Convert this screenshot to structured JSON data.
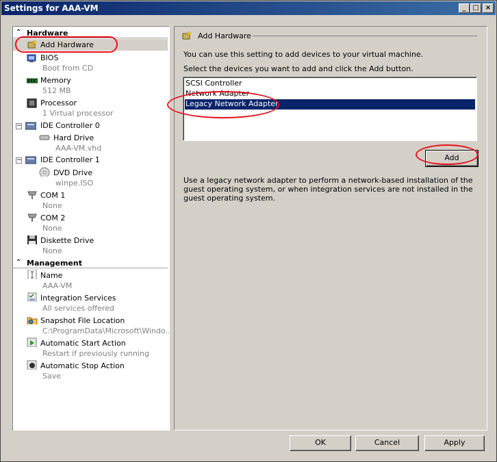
{
  "window": {
    "title": "Settings for AAA-VM"
  },
  "titlebar_buttons": {
    "minimize": "_",
    "maximize": "□",
    "close": "×"
  },
  "left": {
    "sections": {
      "hardware": "Hardware",
      "management": "Management"
    },
    "hardware_items": [
      {
        "name": "Add Hardware",
        "sub": "",
        "icon": "add-hardware-icon"
      },
      {
        "name": "BIOS",
        "sub": "Boot from CD",
        "icon": "bios-icon"
      },
      {
        "name": "Memory",
        "sub": "512 MB",
        "icon": "memory-icon"
      },
      {
        "name": "Processor",
        "sub": "1 Virtual processor",
        "icon": "processor-icon"
      },
      {
        "name": "IDE Controller 0",
        "sub": "",
        "icon": "ide-controller-icon"
      },
      {
        "name": "Hard Drive",
        "sub": "AAA-VM.vhd",
        "icon": "hard-drive-icon"
      },
      {
        "name": "IDE Controller 1",
        "sub": "",
        "icon": "ide-controller-icon"
      },
      {
        "name": "DVD Drive",
        "sub": "winpe.ISO",
        "icon": "dvd-drive-icon"
      },
      {
        "name": "COM 1",
        "sub": "None",
        "icon": "com-port-icon"
      },
      {
        "name": "COM 2",
        "sub": "None",
        "icon": "com-port-icon"
      },
      {
        "name": "Diskette Drive",
        "sub": "None",
        "icon": "diskette-icon"
      }
    ],
    "management_items": [
      {
        "name": "Name",
        "sub": "AAA-VM",
        "icon": "name-icon"
      },
      {
        "name": "Integration Services",
        "sub": "All services offered",
        "icon": "integration-services-icon"
      },
      {
        "name": "Snapshot File Location",
        "sub": "C:\\ProgramData\\Microsoft\\Windo...",
        "icon": "snapshot-folder-icon"
      },
      {
        "name": "Automatic Start Action",
        "sub": "Restart if previously running",
        "icon": "start-action-icon"
      },
      {
        "name": "Automatic Stop Action",
        "sub": "Save",
        "icon": "stop-action-icon"
      }
    ],
    "expander_symbol": "−",
    "collapse_symbol": "≈"
  },
  "right": {
    "group_title": "Add Hardware",
    "intro1": "You can use this setting to add devices to your virtual machine.",
    "intro2": "Select the devices you want to add and click the Add button.",
    "devices": [
      "SCSI Controller",
      "Network Adapter",
      "Legacy Network Adapter"
    ],
    "selected_device": "Legacy Network Adapter",
    "add_button": "Add",
    "description": "Use a legacy network adapter to perform a network-based installation of the guest operating system, or when integration services are not installed in the guest operating system."
  },
  "footer": {
    "ok": "OK",
    "cancel": "Cancel",
    "apply": "Apply"
  },
  "colors": {
    "selection": "#0a246a",
    "annotation": "#e8101a",
    "titlebar": "#0a246a",
    "dim_text": "#808080"
  }
}
